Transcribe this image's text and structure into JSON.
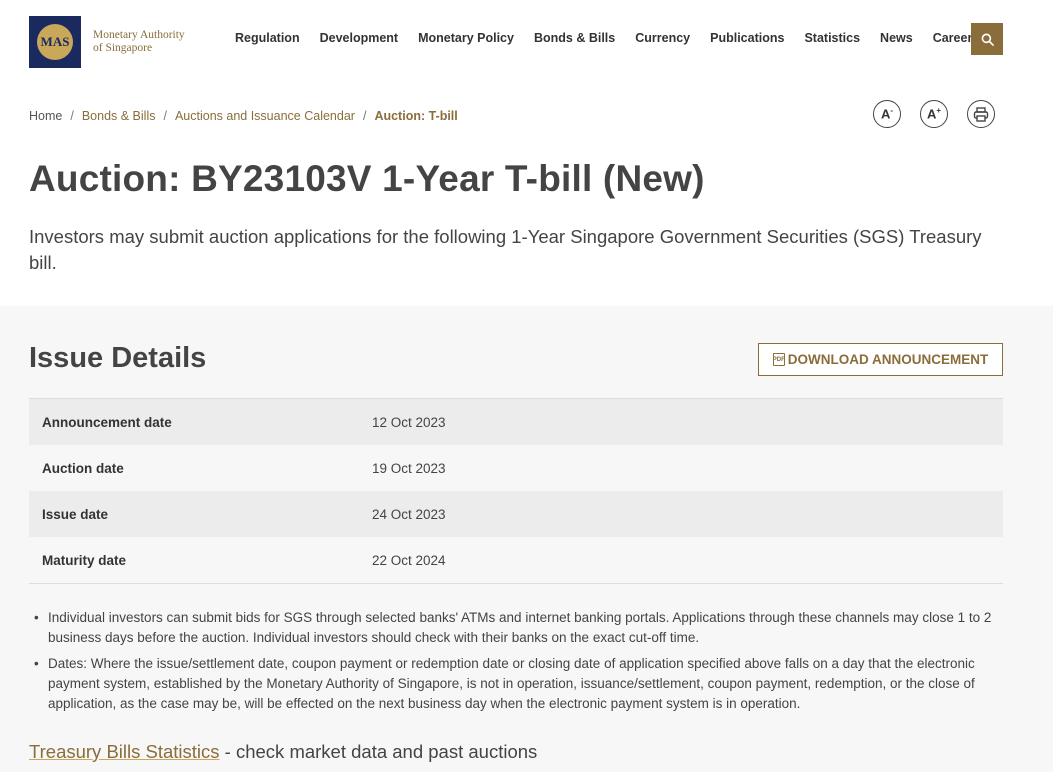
{
  "header": {
    "logo_abbr": "MAS",
    "logo_line1": "Monetary Authority",
    "logo_line2": "of Singapore",
    "nav": [
      "Regulation",
      "Development",
      "Monetary Policy",
      "Bonds & Bills",
      "Currency",
      "Publications",
      "Statistics",
      "News",
      "Careers"
    ],
    "search_icon": "search-icon"
  },
  "breadcrumb": {
    "home": "Home",
    "items": [
      "Bonds & Bills",
      "Auctions and Issuance Calendar"
    ],
    "current": "Auction: T-bill",
    "separator": "/"
  },
  "tools": {
    "decrease_font": "A",
    "decrease_sup": "-",
    "increase_font": "A",
    "increase_sup": "+",
    "print_icon": "printer-icon"
  },
  "page": {
    "title": "Auction: BY23103V 1-Year T-bill (New)",
    "subtitle": "Investors may submit auction applications for the following 1-Year Singapore Government Securities (SGS) Treasury bill."
  },
  "issue_details": {
    "title": "Issue Details",
    "download_label": "DOWNLOAD ANNOUNCEMENT",
    "pdf_icon_text": "PDF",
    "rows": [
      {
        "label": "Announcement date",
        "value": "12 Oct 2023"
      },
      {
        "label": "Auction date",
        "value": "19 Oct 2023"
      },
      {
        "label": "Issue date",
        "value": "24 Oct 2023"
      },
      {
        "label": "Maturity date",
        "value": "22 Oct 2024"
      }
    ],
    "notes": [
      "Individual investors can submit bids for SGS through selected banks' ATMs and internet banking portals. Applications through these channels may close 1 to 2 business days before the auction. Individual investors should check with their banks on the exact cut-off time.",
      "Dates: Where the issue/settlement date, coupon payment or redemption date or closing date of application specified above falls on a day that the electronic payment system, established by the Monetary Authority of Singapore, is not in operation, issuance/settlement, coupon payment, redemption, or the close of application, as the case may be, will be effected on the next business day when the electronic payment system is in operation."
    ]
  },
  "stats": {
    "link": "Treasury Bills Statistics",
    "suffix": " - check market data and past auctions"
  }
}
